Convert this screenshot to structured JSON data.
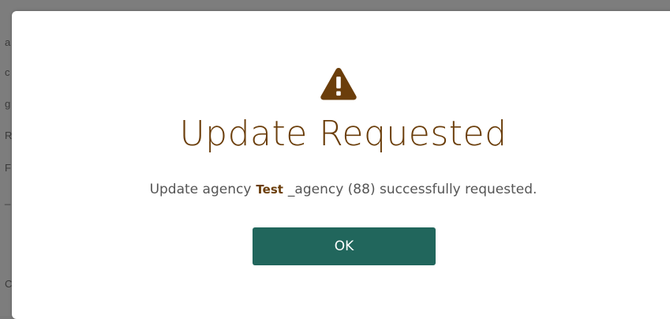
{
  "background": {
    "letters": [
      "a",
      "c",
      "g",
      "R",
      "F",
      "_",
      "C"
    ]
  },
  "dialog": {
    "title": "Update Requested",
    "message": {
      "prefix": "Update agency",
      "highlight": "Test",
      "suffix": "_agency (88) successfully requested."
    },
    "ok_label": "OK",
    "icon": "warning-triangle-icon"
  },
  "colors": {
    "title": "#6b3e0b",
    "icon": "#6b3e0b",
    "button": "#21665c",
    "message": "#555555"
  }
}
